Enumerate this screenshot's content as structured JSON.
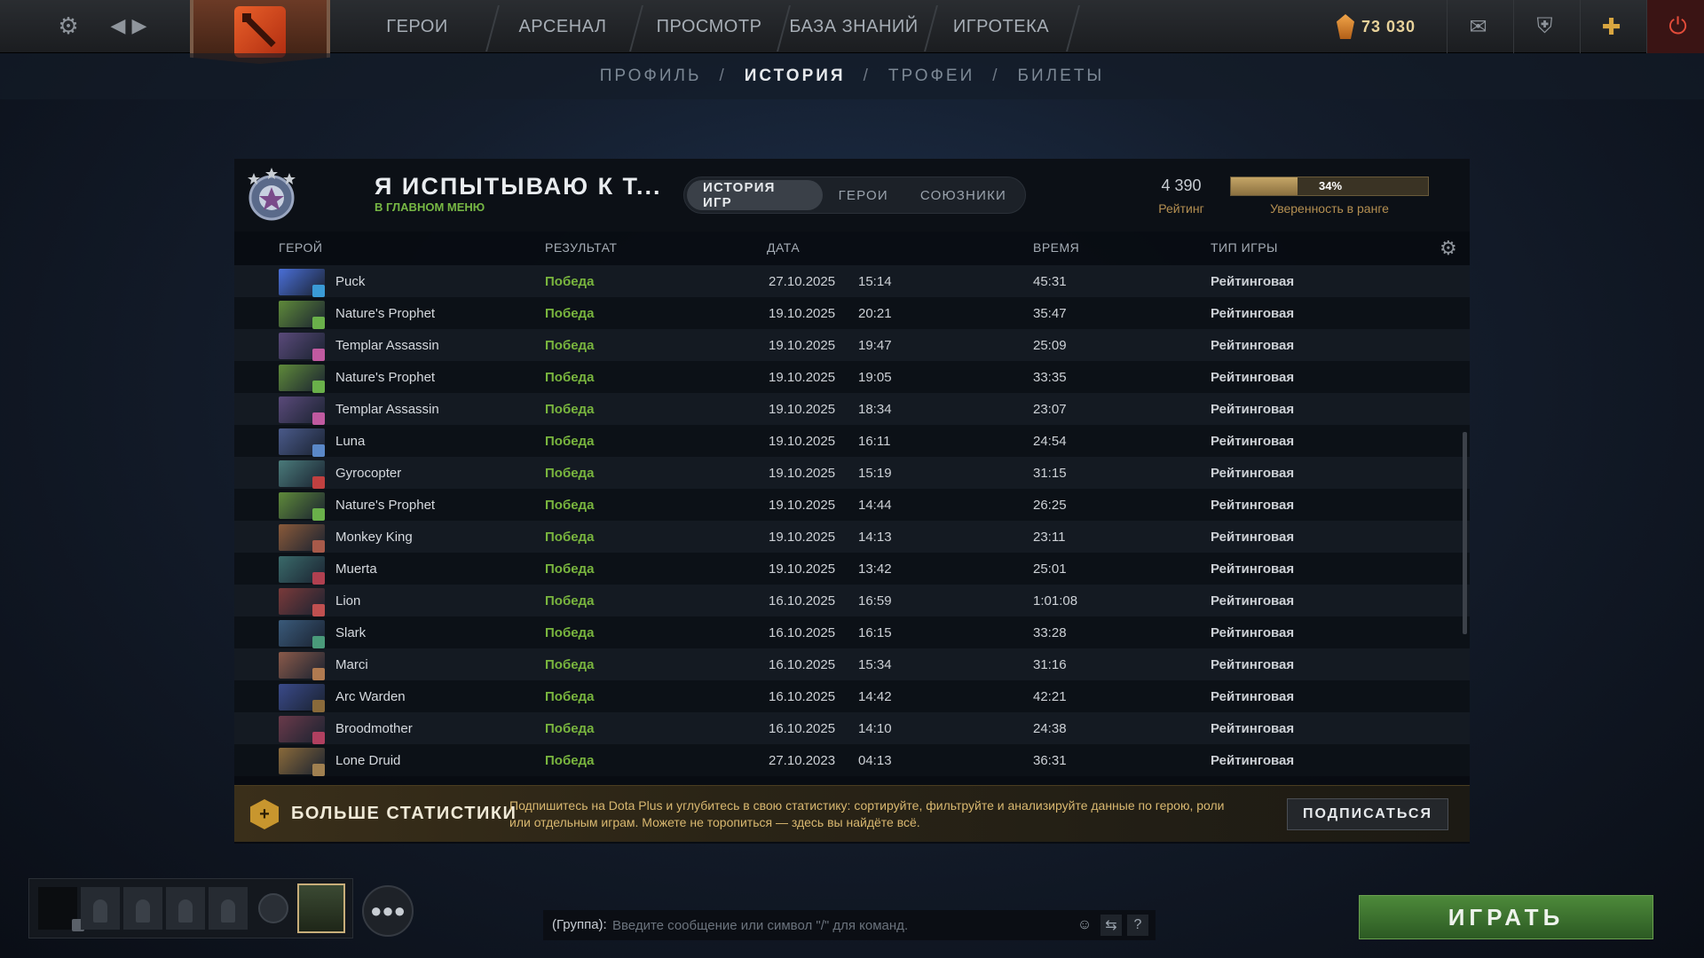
{
  "topbar": {
    "nav": [
      "ГЕРОИ",
      "АРСЕНАЛ",
      "ПРОСМОТР",
      "БАЗА ЗНАНИЙ",
      "ИГРОТЕКА"
    ],
    "shards": "73 030"
  },
  "subnav": {
    "items": [
      "ПРОФИЛЬ",
      "ИСТОРИЯ",
      "ТРОФЕИ",
      "БИЛЕТЫ"
    ],
    "active": "ИСТОРИЯ"
  },
  "profile": {
    "name": "Я ИСПЫТЫВАЮ К Т...",
    "status": "В ГЛАВНОМ МЕНЮ",
    "rating_value": "4 390",
    "rating_label": "Рейтинг",
    "confidence_percent": 34,
    "confidence_text": "34%",
    "confidence_label": "Уверенность в ранге"
  },
  "tabs": [
    "ИСТОРИЯ ИГР",
    "ГЕРОИ",
    "СОЮЗНИКИ"
  ],
  "columns": {
    "hero": "ГЕРОЙ",
    "result": "РЕЗУЛЬТАТ",
    "date": "ДАТА",
    "time": "ВРЕМЯ",
    "type": "ТИП ИГРЫ"
  },
  "matches": [
    {
      "hero": "Puck",
      "result": "Победа",
      "date": "27.10.2025",
      "time": "15:14",
      "duration": "45:31",
      "type": "Рейтинговая",
      "color": "#4a6fd8",
      "badge": "#3a9bd6"
    },
    {
      "hero": "Nature's Prophet",
      "result": "Победа",
      "date": "19.10.2025",
      "time": "20:21",
      "duration": "35:47",
      "type": "Рейтинговая",
      "color": "#5f8a3a",
      "badge": "#6ab04a"
    },
    {
      "hero": "Templar Assassin",
      "result": "Победа",
      "date": "19.10.2025",
      "time": "19:47",
      "duration": "25:09",
      "type": "Рейтинговая",
      "color": "#5a4a7a",
      "badge": "#c05aa0"
    },
    {
      "hero": "Nature's Prophet",
      "result": "Победа",
      "date": "19.10.2025",
      "time": "19:05",
      "duration": "33:35",
      "type": "Рейтинговая",
      "color": "#5f8a3a",
      "badge": "#6ab04a"
    },
    {
      "hero": "Templar Assassin",
      "result": "Победа",
      "date": "19.10.2025",
      "time": "18:34",
      "duration": "23:07",
      "type": "Рейтинговая",
      "color": "#5a4a7a",
      "badge": "#c05aa0"
    },
    {
      "hero": "Luna",
      "result": "Победа",
      "date": "19.10.2025",
      "time": "16:11",
      "duration": "24:54",
      "type": "Рейтинговая",
      "color": "#4a5a8a",
      "badge": "#5a88c8"
    },
    {
      "hero": "Gyrocopter",
      "result": "Победа",
      "date": "19.10.2025",
      "time": "15:19",
      "duration": "31:15",
      "type": "Рейтинговая",
      "color": "#4a7a7a",
      "badge": "#c04040"
    },
    {
      "hero": "Nature's Prophet",
      "result": "Победа",
      "date": "19.10.2025",
      "time": "14:44",
      "duration": "26:25",
      "type": "Рейтинговая",
      "color": "#5f8a3a",
      "badge": "#6ab04a"
    },
    {
      "hero": "Monkey King",
      "result": "Победа",
      "date": "19.10.2025",
      "time": "14:13",
      "duration": "23:11",
      "type": "Рейтинговая",
      "color": "#8a5a3a",
      "badge": "#a85a4a"
    },
    {
      "hero": "Muerta",
      "result": "Победа",
      "date": "19.10.2025",
      "time": "13:42",
      "duration": "25:01",
      "type": "Рейтинговая",
      "color": "#3a6a6a",
      "badge": "#b04050"
    },
    {
      "hero": "Lion",
      "result": "Победа",
      "date": "16.10.2025",
      "time": "16:59",
      "duration": "1:01:08",
      "type": "Рейтинговая",
      "color": "#7a3a3a",
      "badge": "#c05050"
    },
    {
      "hero": "Slark",
      "result": "Победа",
      "date": "16.10.2025",
      "time": "16:15",
      "duration": "33:28",
      "type": "Рейтинговая",
      "color": "#3a5a7a",
      "badge": "#4a9a7a"
    },
    {
      "hero": "Marci",
      "result": "Победа",
      "date": "16.10.2025",
      "time": "15:34",
      "duration": "31:16",
      "type": "Рейтинговая",
      "color": "#8a5a4a",
      "badge": "#b07a50"
    },
    {
      "hero": "Arc Warden",
      "result": "Победа",
      "date": "16.10.2025",
      "time": "14:42",
      "duration": "42:21",
      "type": "Рейтинговая",
      "color": "#3a4a8a",
      "badge": "#8a6a3a"
    },
    {
      "hero": "Broodmother",
      "result": "Победа",
      "date": "16.10.2025",
      "time": "14:10",
      "duration": "24:38",
      "type": "Рейтинговая",
      "color": "#6a3a4a",
      "badge": "#b04060"
    },
    {
      "hero": "Lone Druid",
      "result": "Победа",
      "date": "27.10.2023",
      "time": "04:13",
      "duration": "36:31",
      "type": "Рейтинговая",
      "color": "#8a6a3a",
      "badge": "#a08050"
    }
  ],
  "promo": {
    "title": "БОЛЬШЕ СТАТИСТИКИ",
    "text": "Подпишитесь на Dota Plus и углубитесь в свою статистику: сортируйте, фильтруйте и анализируйте данные по герою, роли или отдельным играм. Можете не торопиться — здесь вы найдёте всё.",
    "button": "ПОДПИСАТЬСЯ"
  },
  "chat": {
    "label": "(Группа):",
    "placeholder": "Введите сообщение или символ \"/\" для команд."
  },
  "play_button": "ИГРАТЬ"
}
